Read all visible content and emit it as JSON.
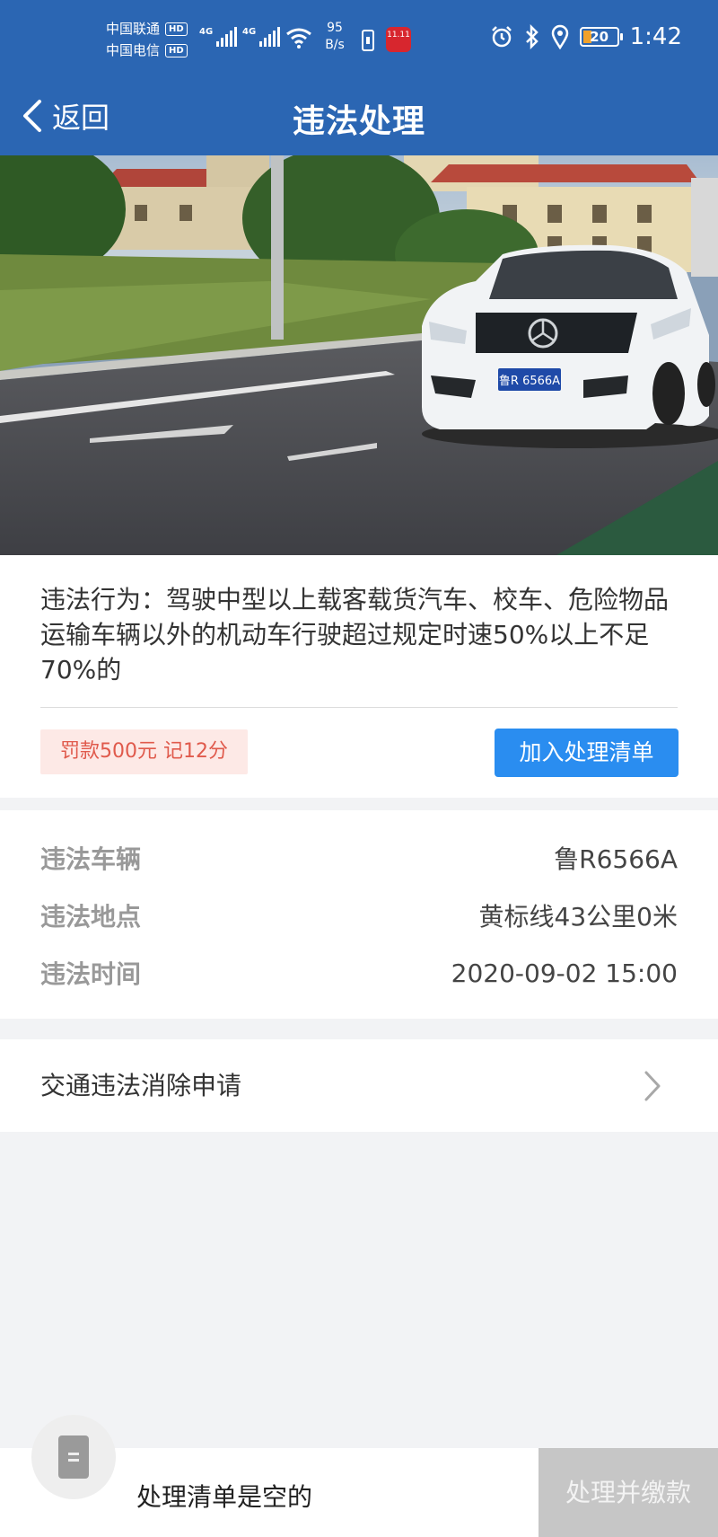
{
  "status_bar": {
    "carrier_1": "中国联通",
    "carrier_2": "中国电信",
    "hd": "HD",
    "network_1": "4G",
    "network_2": "4G",
    "speed_value": "95",
    "speed_unit": "B/s",
    "app_badge": "11.11",
    "battery_level": "20",
    "time": "1:42",
    "icons": [
      "alarm-icon",
      "bluetooth-icon",
      "location-icon"
    ]
  },
  "nav": {
    "back_label": "返回",
    "title": "违法处理"
  },
  "photo": {
    "plate": "鲁R 6566A"
  },
  "violation": {
    "description": "违法行为：驾驶中型以上载客载货汽车、校车、危险物品运输车辆以外的机动车行驶超过规定时速50%以上不足70%的",
    "fine": "罚款500元 记12分",
    "add_button": "加入处理清单"
  },
  "details": [
    {
      "label": "违法车辆",
      "value": "鲁R6566A"
    },
    {
      "label": "违法地点",
      "value": "黄标线43公里0米"
    },
    {
      "label": "违法时间",
      "value": "2020-09-02 15:00"
    }
  ],
  "appeal": {
    "label": "交通违法消除申请"
  },
  "bottom": {
    "empty_text": "处理清单是空的",
    "pay_button": "处理并缴款"
  },
  "colors": {
    "header": "#2b66b3",
    "primary_button": "#2a8df0",
    "fine_text": "#e05a4c",
    "fine_bg": "#fde9e6",
    "disabled_button": "#c6c6c6"
  }
}
